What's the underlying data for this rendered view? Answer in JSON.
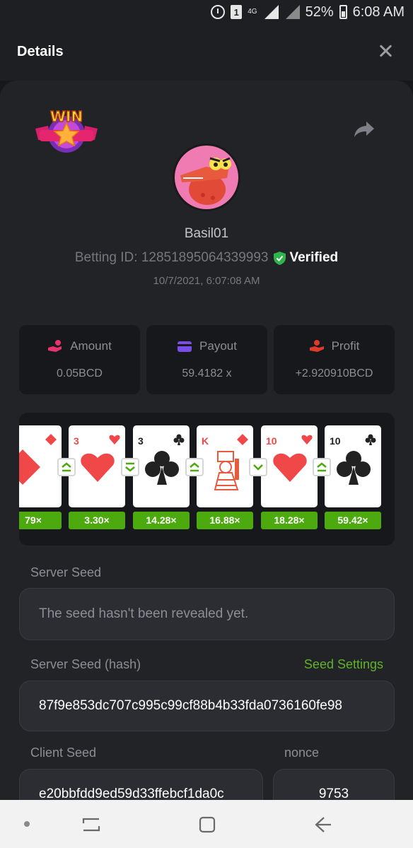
{
  "status_bar": {
    "sim": "1",
    "network": "4G",
    "battery": "52%",
    "time": "6:08 AM"
  },
  "header": {
    "title": "Details"
  },
  "player": {
    "username": "Basil01",
    "betting_id_label": "Betting ID: 128518950643399​93",
    "verified": "Verified",
    "datetime": "10/7/2021, 6:07:08 AM"
  },
  "badge": {
    "text": "WIN"
  },
  "stats": [
    {
      "label": "Amount",
      "value": "0.05BCD",
      "icon": "hand-coins-icon"
    },
    {
      "label": "Payout",
      "value": "59.4182 x",
      "icon": "card-icon"
    },
    {
      "label": "Profit",
      "value": "+2.920910BCD",
      "icon": "hand-profit-icon"
    }
  ],
  "cards": [
    {
      "rank": "",
      "suit": "diamond",
      "color": "red",
      "multiplier": "79×",
      "arrow": "up"
    },
    {
      "rank": "3",
      "suit": "heart",
      "color": "red",
      "multiplier": "3.30×",
      "arrow": "down"
    },
    {
      "rank": "3",
      "suit": "club",
      "color": "black",
      "multiplier": "14.28×",
      "arrow": "up"
    },
    {
      "rank": "K",
      "suit": "diamond",
      "color": "red",
      "multiplier": "16.88×",
      "arrow": "down"
    },
    {
      "rank": "10",
      "suit": "heart",
      "color": "red",
      "multiplier": "18.28×",
      "arrow": "up"
    },
    {
      "rank": "10",
      "suit": "club",
      "color": "black",
      "multiplier": "59.42×",
      "arrow": ""
    }
  ],
  "seeds": {
    "server_seed_label": "Server Seed",
    "server_seed_value": "The seed hasn't been revealed yet.",
    "server_hash_label": "Server Seed (hash)",
    "seed_settings": "Seed Settings",
    "server_hash_value": "87f9e853dc707c995c99cf88b4b33fda0736160fe98",
    "client_seed_label": "Client Seed",
    "client_seed_value": "e20bbfdd9ed59d33ffebcf1da0c",
    "nonce_label": "nonce",
    "nonce_value": "9753"
  },
  "colors": {
    "accent_green": "#4caa0f",
    "link_green": "#5fb32a",
    "verified_green": "#2fb34a",
    "panel": "#222327"
  }
}
